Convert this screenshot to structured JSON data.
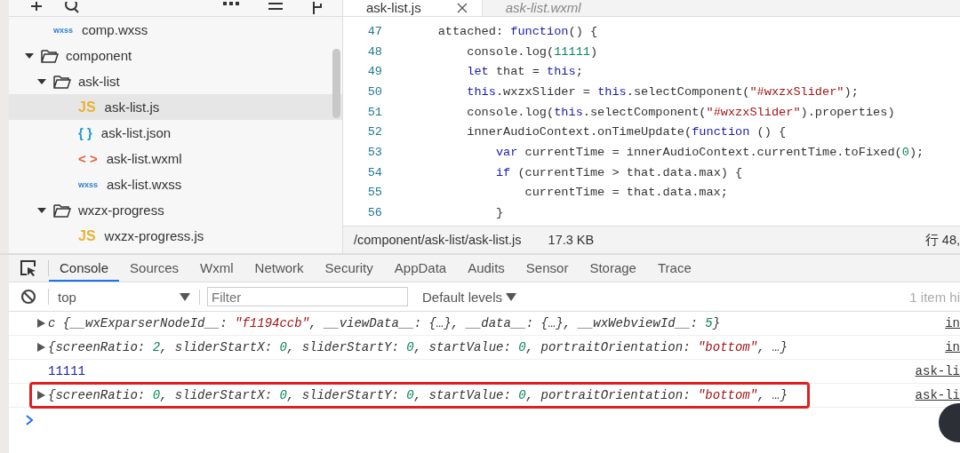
{
  "sidebar": {
    "tree": [
      {
        "name": "comp.wxss",
        "kind": "file",
        "badge": "wxss",
        "color": "#2f7fd0",
        "selected": false
      },
      {
        "name": "component",
        "kind": "folder",
        "expanded": true,
        "selected": false,
        "children": [
          {
            "name": "ask-list",
            "kind": "folder",
            "expanded": true,
            "selected": false,
            "children": [
              {
                "name": "ask-list.js",
                "kind": "file",
                "badge": "JS",
                "color": "#e8b234",
                "selected": true
              },
              {
                "name": "ask-list.json",
                "kind": "file",
                "badge": "{ }",
                "color": "#1f9bd6",
                "selected": false
              },
              {
                "name": "ask-list.wxml",
                "kind": "file",
                "badge": "< >",
                "color": "#e0603a",
                "selected": false
              },
              {
                "name": "ask-list.wxss",
                "kind": "file",
                "badge": "wxss",
                "color": "#2f7fd0",
                "selected": false
              }
            ]
          },
          {
            "name": "wxzx-progress",
            "kind": "folder",
            "expanded": true,
            "selected": false,
            "children": [
              {
                "name": "wxzx-progress.js",
                "kind": "file",
                "badge": "JS",
                "color": "#e8b234",
                "selected": false
              }
            ]
          }
        ]
      }
    ]
  },
  "editor": {
    "tabs": [
      {
        "label": "ask-list.js",
        "selected": true,
        "closable": true
      },
      {
        "label": "ask-list.wxml",
        "selected": false,
        "closable": false
      }
    ],
    "lines": [
      {
        "n": "47",
        "tokens": [
          {
            "kind": "plain",
            "text": "    attached: "
          },
          {
            "kind": "keyword",
            "text": "function"
          },
          {
            "kind": "plain",
            "text": "() {"
          }
        ]
      },
      {
        "n": "48",
        "tokens": [
          {
            "kind": "plain",
            "text": "        console.log("
          },
          {
            "kind": "number",
            "text": "11111"
          },
          {
            "kind": "plain",
            "text": ")"
          }
        ]
      },
      {
        "n": "49",
        "tokens": [
          {
            "kind": "keyword",
            "text": "        let"
          },
          {
            "kind": "plain",
            "text": " that = "
          },
          {
            "kind": "keyword",
            "text": "this"
          },
          {
            "kind": "plain",
            "text": ";"
          }
        ]
      },
      {
        "n": "50",
        "tokens": [
          {
            "kind": "keyword",
            "text": "        this"
          },
          {
            "kind": "plain",
            "text": ".wxzxSlider = "
          },
          {
            "kind": "keyword",
            "text": "this"
          },
          {
            "kind": "plain",
            "text": ".selectComponent("
          },
          {
            "kind": "string",
            "text": "\"#wxzxSlider\""
          },
          {
            "kind": "plain",
            "text": ");"
          }
        ]
      },
      {
        "n": "51",
        "tokens": [
          {
            "kind": "plain",
            "text": "        console.log("
          },
          {
            "kind": "keyword",
            "text": "this"
          },
          {
            "kind": "plain",
            "text": ".selectComponent("
          },
          {
            "kind": "string",
            "text": "\"#wxzxSlider\""
          },
          {
            "kind": "plain",
            "text": ").properties)"
          }
        ]
      },
      {
        "n": "52",
        "tokens": [
          {
            "kind": "plain",
            "text": "        innerAudioContext.onTimeUpdate("
          },
          {
            "kind": "keyword",
            "text": "function"
          },
          {
            "kind": "plain",
            "text": " () {"
          }
        ]
      },
      {
        "n": "53",
        "tokens": [
          {
            "kind": "keyword",
            "text": "            var"
          },
          {
            "kind": "plain",
            "text": " currentTime = innerAudioContext.currentTime.toFixed("
          },
          {
            "kind": "number",
            "text": "0"
          },
          {
            "kind": "plain",
            "text": ");"
          }
        ]
      },
      {
        "n": "54",
        "tokens": [
          {
            "kind": "keyword",
            "text": "            if"
          },
          {
            "kind": "plain",
            "text": " (currentTime > that.data.max) {"
          }
        ]
      },
      {
        "n": "55",
        "tokens": [
          {
            "kind": "plain",
            "text": "                currentTime = that.data.max;"
          }
        ]
      },
      {
        "n": "56",
        "tokens": [
          {
            "kind": "plain",
            "text": "            }"
          }
        ]
      }
    ],
    "status": {
      "path": "/component/ask-list/ask-list.js",
      "size": "17.3 KB",
      "position": "行 48,"
    }
  },
  "devtools": {
    "tabs": [
      {
        "label": "Console",
        "selected": true
      },
      {
        "label": "Sources",
        "selected": false
      },
      {
        "label": "Wxml",
        "selected": false
      },
      {
        "label": "Network",
        "selected": false
      },
      {
        "label": "Security",
        "selected": false
      },
      {
        "label": "AppData",
        "selected": false
      },
      {
        "label": "Audits",
        "selected": false
      },
      {
        "label": "Sensor",
        "selected": false
      },
      {
        "label": "Storage",
        "selected": false
      },
      {
        "label": "Trace",
        "selected": false
      }
    ],
    "context": "top",
    "filter": {
      "placeholder": "Filter"
    },
    "levels": "Default levels",
    "hidden_count": "1 item hi",
    "messages": [
      {
        "expandable": true,
        "highlighted": false,
        "tokens": [
          {
            "kind": "plain",
            "text": "c {__wxExparserNodeId__: "
          },
          {
            "kind": "string",
            "text": "\"f1194ccb\""
          },
          {
            "kind": "plain",
            "text": ", __viewData__: {…}, __data__: {…}, __wxWebviewId__: "
          },
          {
            "kind": "number",
            "text": "5"
          },
          {
            "kind": "plain",
            "text": "}"
          }
        ],
        "source": "in"
      },
      {
        "expandable": true,
        "highlighted": false,
        "tokens": [
          {
            "kind": "plain",
            "text": "{screenRatio: "
          },
          {
            "kind": "number",
            "text": "2"
          },
          {
            "kind": "plain",
            "text": ", sliderStartX: "
          },
          {
            "kind": "number",
            "text": "0"
          },
          {
            "kind": "plain",
            "text": ", sliderStartY: "
          },
          {
            "kind": "number",
            "text": "0"
          },
          {
            "kind": "plain",
            "text": ", startValue: "
          },
          {
            "kind": "number",
            "text": "0"
          },
          {
            "kind": "plain",
            "text": ", portraitOrientation: "
          },
          {
            "kind": "string",
            "text": "\"bottom\""
          },
          {
            "kind": "plain",
            "text": ", …}"
          }
        ],
        "source": "in"
      },
      {
        "expandable": false,
        "highlighted": false,
        "tokens": [
          {
            "kind": "value",
            "text": "11111"
          }
        ],
        "source": "ask-li"
      },
      {
        "expandable": true,
        "highlighted": true,
        "tokens": [
          {
            "kind": "plain",
            "text": "{screenRatio: "
          },
          {
            "kind": "number",
            "text": "0"
          },
          {
            "kind": "plain",
            "text": ", sliderStartX: "
          },
          {
            "kind": "number",
            "text": "0"
          },
          {
            "kind": "plain",
            "text": ", sliderStartY: "
          },
          {
            "kind": "number",
            "text": "0"
          },
          {
            "kind": "plain",
            "text": ", startValue: "
          },
          {
            "kind": "number",
            "text": "0"
          },
          {
            "kind": "plain",
            "text": ", portraitOrientation: "
          },
          {
            "kind": "string",
            "text": "\"bottom\""
          },
          {
            "kind": "plain",
            "text": ", …}"
          }
        ],
        "source": "ask-li"
      }
    ]
  }
}
